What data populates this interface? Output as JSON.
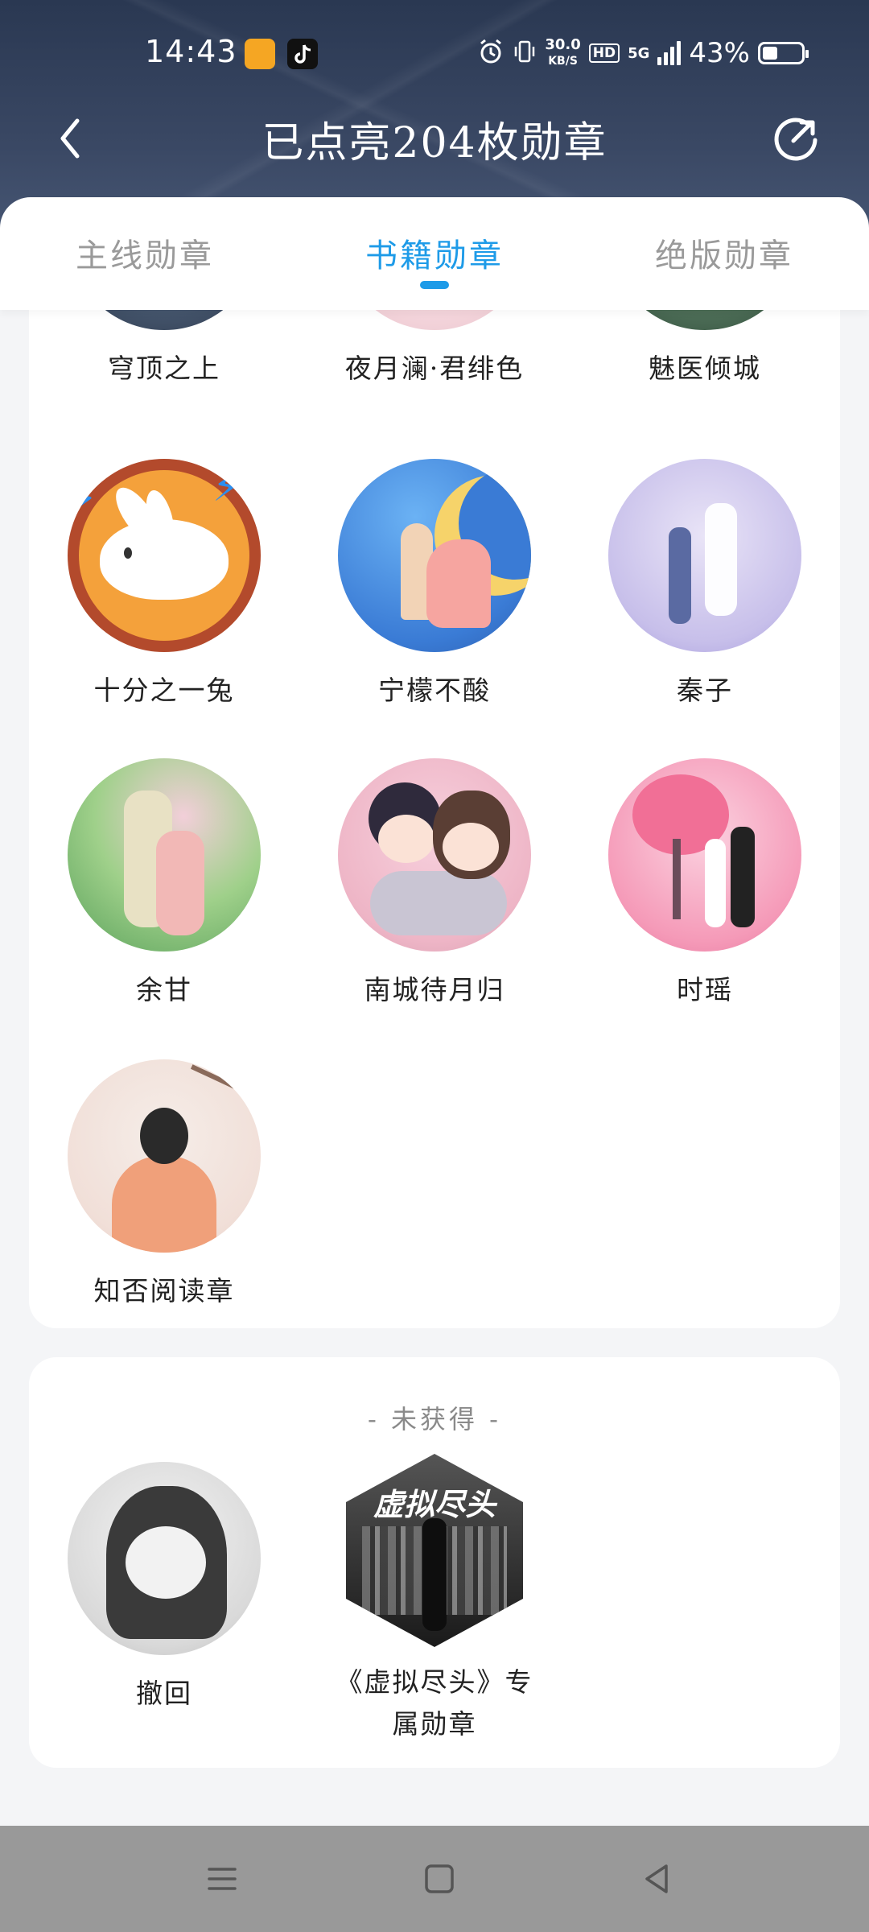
{
  "status_bar": {
    "time": "14:43",
    "net_speed_top": "30.0",
    "net_speed_unit": "KB/S",
    "hd": "HD",
    "network": "5G",
    "battery": "43%",
    "app_icons": [
      "weibo-icon",
      "tiktok-icon"
    ]
  },
  "header": {
    "title": "已点亮204枚勋章",
    "back_icon": "chevron-left-icon",
    "refresh_icon": "refresh-icon"
  },
  "tabs": [
    {
      "label": "主线勋章",
      "active": false
    },
    {
      "label": "书籍勋章",
      "active": true
    },
    {
      "label": "绝版勋章",
      "active": false
    }
  ],
  "earned_badges": [
    {
      "name": "穹顶之上"
    },
    {
      "name": "夜月澜·君绯色"
    },
    {
      "name": "魅医倾城"
    },
    {
      "name": "十分之一兔"
    },
    {
      "name": "宁檬不酸"
    },
    {
      "name": "秦子"
    },
    {
      "name": "余甘"
    },
    {
      "name": "南城待月归"
    },
    {
      "name": "时瑶"
    },
    {
      "name": "知否阅读章"
    }
  ],
  "locked_section": {
    "title": "- 未获得 -",
    "badges": [
      {
        "name": "撤回"
      },
      {
        "name": "《虚拟尽头》专属勋章",
        "line1": "《虚拟尽头》专",
        "line2": "属勋章",
        "logo_text": "虚拟尽头"
      }
    ]
  },
  "colors": {
    "accent": "#1e9be8",
    "header_bg": "#2f3d58",
    "page_bg": "#f4f5f7",
    "nav_bg": "#999999"
  },
  "nav_bar": {
    "icons": [
      "menu-icon",
      "home-icon",
      "back-triangle-icon"
    ]
  }
}
